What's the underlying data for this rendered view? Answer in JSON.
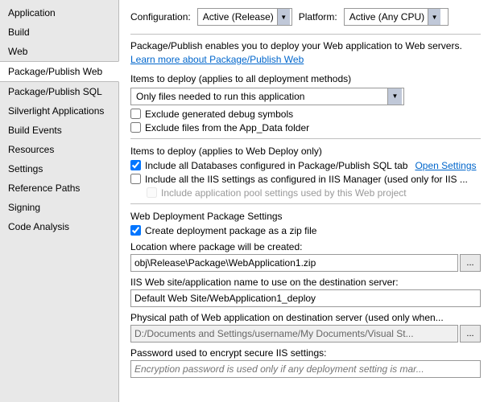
{
  "sidebar": {
    "items": [
      {
        "id": "application",
        "label": "Application",
        "active": false
      },
      {
        "id": "build",
        "label": "Build",
        "active": false
      },
      {
        "id": "web",
        "label": "Web",
        "active": false
      },
      {
        "id": "package-publish-web",
        "label": "Package/Publish Web",
        "active": true
      },
      {
        "id": "package-publish-sql",
        "label": "Package/Publish SQL",
        "active": false
      },
      {
        "id": "silverlight-applications",
        "label": "Silverlight Applications",
        "active": false
      },
      {
        "id": "build-events",
        "label": "Build Events",
        "active": false
      },
      {
        "id": "resources",
        "label": "Resources",
        "active": false
      },
      {
        "id": "settings",
        "label": "Settings",
        "active": false
      },
      {
        "id": "reference-paths",
        "label": "Reference Paths",
        "active": false
      },
      {
        "id": "signing",
        "label": "Signing",
        "active": false
      },
      {
        "id": "code-analysis",
        "label": "Code Analysis",
        "active": false
      }
    ]
  },
  "header": {
    "configuration_label": "Configuration:",
    "configuration_value": "Active (Release)",
    "platform_label": "Platform:",
    "platform_value": "Active (Any CPU)"
  },
  "main": {
    "description_line1": "Package/Publish enables you to deploy your Web application to Web servers.",
    "description_link": "Learn more about Package/Publish Web",
    "section1_header": "Items to deploy (applies to all deployment methods)",
    "deploy_dropdown_value": "Only files needed to run this application",
    "checkbox1_label": "Exclude generated debug symbols",
    "checkbox2_label": "Exclude files from the App_Data folder",
    "section2_header": "Items to deploy (applies to Web Deploy only)",
    "checkbox3_label": "Include all Databases configured in Package/Publish SQL tab",
    "checkbox3_checked": true,
    "open_settings_label": "Open Settings",
    "checkbox4_label": "Include all the IIS settings as configured in IIS Manager (used only for IIS ...",
    "checkbox5_label": "Include application pool settings used by this Web project",
    "section3_header": "Web Deployment Package Settings",
    "checkbox6_label": "Create deployment package as a zip file",
    "checkbox6_checked": true,
    "location_label": "Location where package will be created:",
    "location_value": "obj\\Release\\Package\\WebApplication1.zip",
    "iis_label": "IIS Web site/application name to use on the destination server:",
    "iis_value": "Default Web Site/WebApplication1_deploy",
    "physical_label": "Physical path of Web application on destination server (used only when...",
    "physical_value": "D:/Documents and Settings/username/My Documents/Visual St...",
    "password_label": "Password used to encrypt secure IIS settings:",
    "password_placeholder": "Encryption password is used only if any deployment setting is mar...",
    "browse_label": "..."
  }
}
